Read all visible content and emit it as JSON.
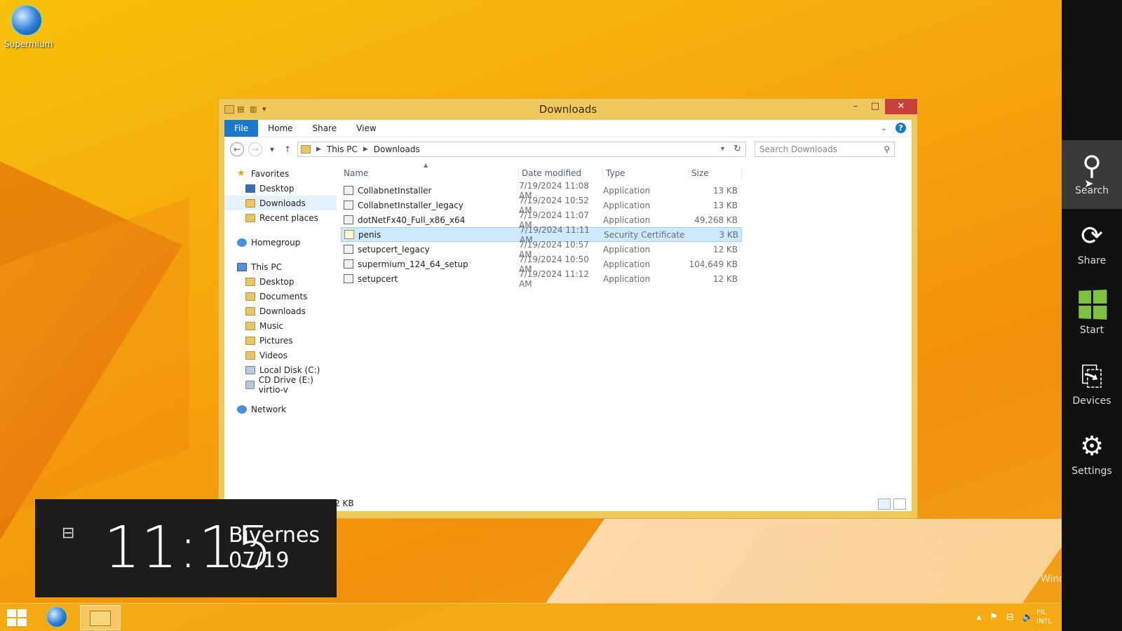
{
  "desktop": {
    "icon_label": "Supermium"
  },
  "window": {
    "title": "Downloads",
    "ribbon_tabs": [
      "File",
      "Home",
      "Share",
      "View"
    ],
    "address": {
      "crumbs": [
        "This PC",
        "Downloads"
      ]
    },
    "search_placeholder": "Search Downloads",
    "nav": {
      "favorites": "Favorites",
      "fav_items": [
        "Desktop",
        "Downloads",
        "Recent places"
      ],
      "homegroup": "Homegroup",
      "thispc": "This PC",
      "pc_items": [
        "Desktop",
        "Documents",
        "Downloads",
        "Music",
        "Pictures",
        "Videos",
        "Local Disk (C:)",
        "CD Drive (E:) virtio-v"
      ],
      "network": "Network"
    },
    "columns": [
      "Name",
      "Date modified",
      "Type",
      "Size"
    ],
    "files": [
      {
        "name": "CollabnetInstaller",
        "date": "7/19/2024 11:08 AM",
        "type": "Application",
        "size": "13 KB"
      },
      {
        "name": "CollabnetInstaller_legacy",
        "date": "7/19/2024 10:52 AM",
        "type": "Application",
        "size": "13 KB"
      },
      {
        "name": "dotNetFx40_Full_x86_x64",
        "date": "7/19/2024 11:07 AM",
        "type": "Application",
        "size": "49,268 KB"
      },
      {
        "name": "penis",
        "date": "7/19/2024 11:11 AM",
        "type": "Security Certificate",
        "size": "3 KB"
      },
      {
        "name": "setupcert_legacy",
        "date": "7/19/2024 10:57 AM",
        "type": "Application",
        "size": "12 KB"
      },
      {
        "name": "supermium_124_64_setup",
        "date": "7/19/2024 10:50 AM",
        "type": "Application",
        "size": "104,649 KB"
      },
      {
        "name": "setupcert",
        "date": "7/19/2024 11:12 AM",
        "type": "Application",
        "size": "12 KB"
      }
    ],
    "status_visible": "2.02 KB"
  },
  "clock": {
    "time": "11:15",
    "day": "Biyernes",
    "date": "07/19"
  },
  "charms": [
    "Search",
    "Share",
    "Start",
    "Devices",
    "Settings"
  ],
  "taskbar": {
    "tray_text_1": "FIL",
    "tray_text_2": "INTL",
    "win_watermark": "Wind"
  }
}
